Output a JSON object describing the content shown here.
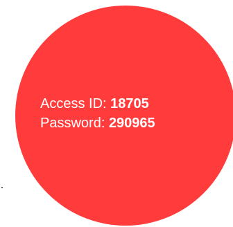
{
  "colors": {
    "circle_fill": "#ff3b3b",
    "text": "#ffffff"
  },
  "credentials": {
    "access_id_label": "Access ID:",
    "access_id_value": "18705",
    "password_label": "Password:",
    "password_value": "290965"
  }
}
